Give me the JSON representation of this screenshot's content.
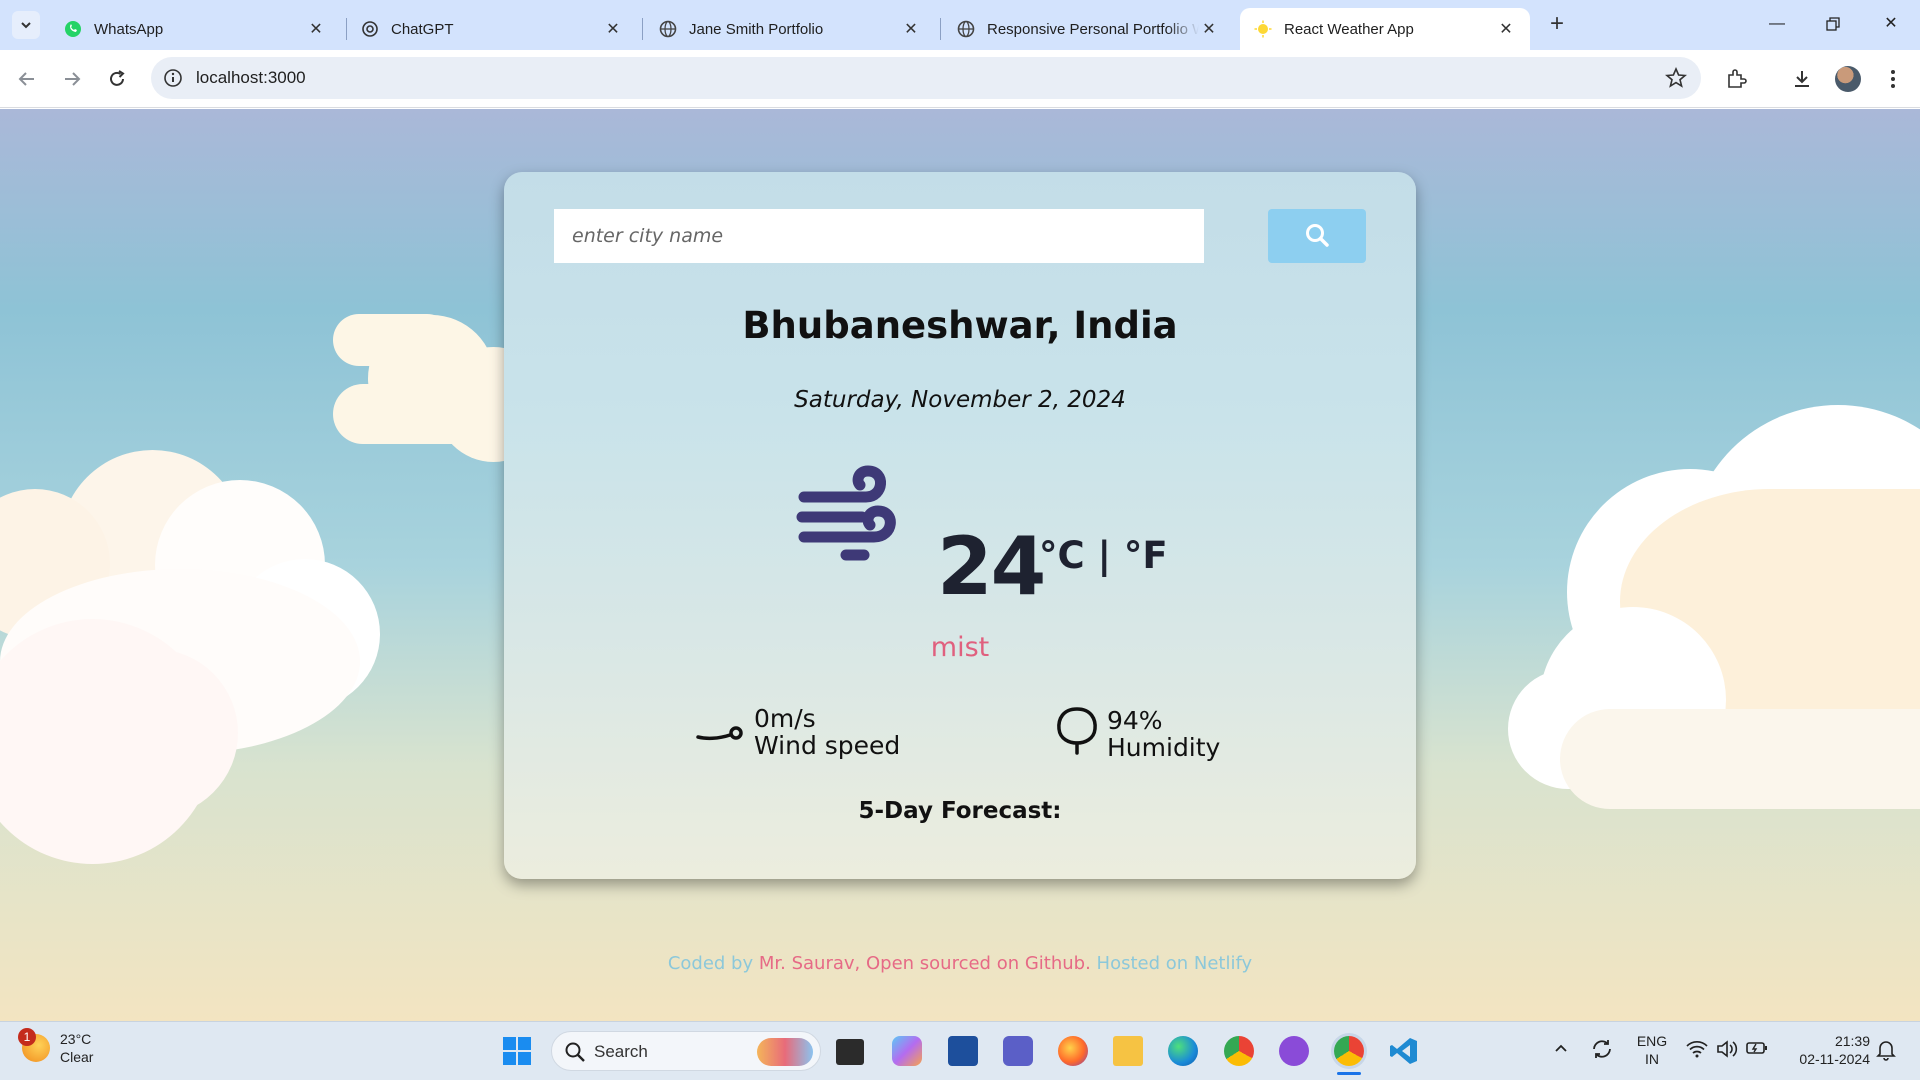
{
  "browser": {
    "tabs": [
      {
        "title": "WhatsApp",
        "icon": "whatsapp-icon",
        "active": false
      },
      {
        "title": "ChatGPT",
        "icon": "chatgpt-icon",
        "active": false
      },
      {
        "title": "Jane Smith Portfolio",
        "icon": "globe-icon",
        "active": false
      },
      {
        "title": "Responsive Personal Portfolio W",
        "icon": "globe-icon",
        "active": false
      },
      {
        "title": "React Weather App",
        "icon": "sun-icon",
        "active": true
      }
    ],
    "url": "localhost:3000"
  },
  "app": {
    "search_placeholder": "enter city name",
    "city": "Bhubaneshwar, India",
    "date": "Saturday, November 2, 2024",
    "temperature": "24",
    "units": "°C | °F",
    "description": "mist",
    "wind": {
      "value": "0m/s",
      "label": "Wind speed"
    },
    "humidity": {
      "value": "94%",
      "label": "Humidity"
    },
    "forecast_title": "5-Day Forecast:"
  },
  "footer": {
    "part1": "Coded by ",
    "author": "Mr. Saurav",
    "part2": ", ",
    "github": "Open sourced on Github.",
    "part3": " Hosted on Netlify"
  },
  "taskbar": {
    "weather_temp": "23°C",
    "weather_desc": "Clear",
    "weather_badge": "1",
    "search_label": "Search",
    "lang_line1": "ENG",
    "lang_line2": "IN",
    "time": "21:39",
    "date": "02-11-2024"
  },
  "colors": {
    "accent_pink": "#e66a86",
    "search_button": "#8dcff0",
    "tab_strip": "#d3e3fd"
  }
}
